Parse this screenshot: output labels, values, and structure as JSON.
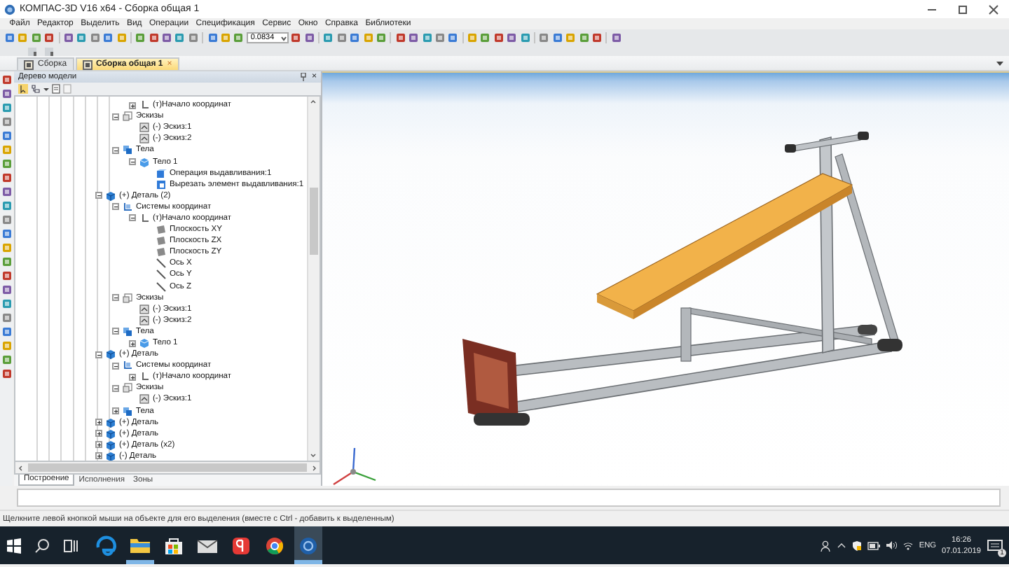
{
  "window": {
    "title": "КОМПАС-3D V16  x64 - Сборка общая 1"
  },
  "menu": [
    "Файл",
    "Редактор",
    "Выделить",
    "Вид",
    "Операции",
    "Спецификация",
    "Сервис",
    "Окно",
    "Справка",
    "Библиотеки"
  ],
  "toolbar": {
    "zoom": "0.0834"
  },
  "doc_tabs": [
    {
      "label": "Сборка",
      "selected": false
    },
    {
      "label": "Сборка общая 1",
      "selected": true,
      "close": "×"
    }
  ],
  "tree_panel": {
    "title": "Дерево модели",
    "close": "×",
    "items": [
      {
        "children": [
          {
            "children": [
              {
                "label": "(т)Начало координат",
                "kind": "origin",
                "expanded": false
              }
            ]
          },
          {
            "label": "Эскизы",
            "kind": "sketches",
            "expanded": true,
            "children": [
              {
                "label": "(-) Эскиз:1",
                "kind": "sketch"
              },
              {
                "label": "(-) Эскиз:2",
                "kind": "sketch"
              }
            ]
          },
          {
            "label": "Тела",
            "kind": "bodies",
            "expanded": true,
            "children": [
              {
                "label": "Тело 1",
                "kind": "body",
                "expanded": true,
                "children": [
                  {
                    "label": "Операция выдавливания:1",
                    "kind": "extrude"
                  },
                  {
                    "label": "Вырезать элемент выдавливания:1",
                    "kind": "cut"
                  }
                ]
              }
            ]
          }
        ]
      },
      {
        "label": "(+) Деталь (2)",
        "kind": "detail",
        "expanded": true,
        "children": [
          {
            "label": "Системы координат",
            "kind": "csys",
            "expanded": true,
            "children": [
              {
                "label": "(т)Начало координат",
                "kind": "origin",
                "expanded": true,
                "children": [
                  {
                    "label": "Плоскость XY",
                    "kind": "plane"
                  },
                  {
                    "label": "Плоскость ZX",
                    "kind": "plane"
                  },
                  {
                    "label": "Плоскость ZY",
                    "kind": "plane"
                  },
                  {
                    "label": "Ось X",
                    "kind": "axis"
                  },
                  {
                    "label": "Ось Y",
                    "kind": "axis"
                  },
                  {
                    "label": "Ось Z",
                    "kind": "axis"
                  }
                ]
              }
            ]
          },
          {
            "label": "Эскизы",
            "kind": "sketches",
            "expanded": true,
            "children": [
              {
                "label": "(-) Эскиз:1",
                "kind": "sketch"
              },
              {
                "label": "(-) Эскиз:2",
                "kind": "sketch"
              }
            ]
          },
          {
            "label": "Тела",
            "kind": "bodies",
            "expanded": true,
            "children": [
              {
                "label": "Тело 1",
                "kind": "body",
                "expanded": false
              }
            ]
          }
        ]
      },
      {
        "label": "(+) Деталь",
        "kind": "detail",
        "expanded": true,
        "children": [
          {
            "label": "Системы координат",
            "kind": "csys",
            "expanded": true,
            "children": [
              {
                "label": "(т)Начало координат",
                "kind": "origin",
                "expanded": false
              }
            ]
          },
          {
            "label": "Эскизы",
            "kind": "sketches",
            "expanded": true,
            "children": [
              {
                "label": "(-) Эскиз:1",
                "kind": "sketch"
              }
            ]
          },
          {
            "label": "Тела",
            "kind": "bodies",
            "expanded": false
          }
        ]
      },
      {
        "label": "(+) Деталь",
        "kind": "detail",
        "expanded": false
      },
      {
        "label": "(+) Деталь",
        "kind": "detail",
        "expanded": false
      },
      {
        "label": "(+) Деталь (x2)",
        "kind": "detail",
        "expanded": false
      },
      {
        "label": "(-) Деталь",
        "kind": "detail",
        "expanded": false
      }
    ],
    "tabs": [
      {
        "label": "Построение",
        "selected": true
      },
      {
        "label": "Исполнения",
        "selected": false
      },
      {
        "label": "Зоны",
        "selected": false
      }
    ]
  },
  "status_bar": "Щелкните левой кнопкой мыши на объекте для его выделения (вместе с Ctrl - добавить к выделенным)",
  "taskbar": {
    "apps": [
      {
        "kind": "edge",
        "running": false,
        "selected": false
      },
      {
        "kind": "explorer",
        "running": true,
        "selected": false
      },
      {
        "kind": "store",
        "running": false,
        "selected": false
      },
      {
        "kind": "mail",
        "running": false,
        "selected": false
      },
      {
        "kind": "yandex",
        "running": false,
        "selected": false
      },
      {
        "kind": "chrome",
        "running": false,
        "selected": false
      },
      {
        "kind": "kompas",
        "running": true,
        "selected": true
      }
    ],
    "language": "ENG",
    "time": "16:26",
    "date": "07.01.2019",
    "notifications": "1"
  }
}
